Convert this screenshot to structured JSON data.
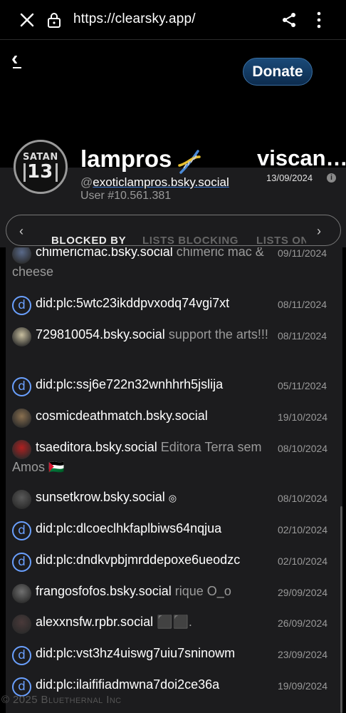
{
  "browser": {
    "url": "https://clearsky.app/"
  },
  "header": {
    "back_label": "‹",
    "donate_label": "Donate"
  },
  "profile": {
    "avatar_text_top": "SATAN",
    "avatar_text_num": "13",
    "name": "lampros",
    "handle_prefix": "@",
    "handle": "exoticlampros.bsky.social",
    "user_number": "User #10.561.381"
  },
  "other_account": {
    "name": "viscan…",
    "date": "13/09/2024",
    "info_icon": "i"
  },
  "tabs": {
    "prev_arrow": "‹",
    "next_arrow": "›",
    "items": [
      "BLOCKED BY",
      "LISTS BLOCKING",
      "LISTS ON"
    ]
  },
  "rows": [
    {
      "handle": "chimericmac.bsky.social",
      "display": "chimeric mac & cheese",
      "date": "09/11/2024",
      "icon": "avatar",
      "color": "#5a6a8a"
    },
    {
      "handle": "did:plc:5wtc23ikddpvxodq74vgi7xt",
      "display": "",
      "date": "08/11/2024",
      "icon": "did"
    },
    {
      "handle": "729810054.bsky.social",
      "display": "support the arts!!!",
      "date": "08/11/2024",
      "icon": "avatar",
      "color": "#c9c0a0"
    },
    {
      "handle": "did:plc:ssj6e722n32wnhhrh5jslija",
      "display": "",
      "date": "05/11/2024",
      "icon": "did"
    },
    {
      "handle": "cosmicdeathmatch.bsky.social",
      "display": "",
      "date": "19/10/2024",
      "icon": "avatar",
      "color": "#8a7050"
    },
    {
      "handle": "tsaeditora.bsky.social",
      "display": "Editora Terra sem Amos 🇵🇸",
      "date": "08/10/2024",
      "icon": "avatar",
      "color": "#b02020"
    },
    {
      "handle": "sunsetkrow.bsky.social",
      "display": "",
      "date": "08/10/2024",
      "icon": "avatar",
      "color": "#5a5a5a",
      "extra": "◎"
    },
    {
      "handle": "did:plc:dlcoeclhkfaplbiws64nqjua",
      "display": "",
      "date": "02/10/2024",
      "icon": "did"
    },
    {
      "handle": "did:plc:dndkvpbjmrddepoxe6ueodzc",
      "display": "",
      "date": "02/10/2024",
      "icon": "did"
    },
    {
      "handle": "frangosfofos.bsky.social",
      "display": "rique O_o",
      "date": "29/09/2024",
      "icon": "avatar",
      "color": "#707070"
    },
    {
      "handle": "alexxnsfw.rpbr.social",
      "display": "⬛⬛.",
      "date": "26/09/2024",
      "icon": "avatar",
      "color": "#4a3a3a"
    },
    {
      "handle": "did:plc:vst3hz4uiswg7uiu7sninowm",
      "display": "",
      "date": "23/09/2024",
      "icon": "did"
    },
    {
      "handle": "did:plc:ilaififiadmwna7doi2ce36a",
      "display": "",
      "date": "19/09/2024",
      "icon": "did"
    }
  ],
  "footer": "© 2025 Bluethernal Inc"
}
